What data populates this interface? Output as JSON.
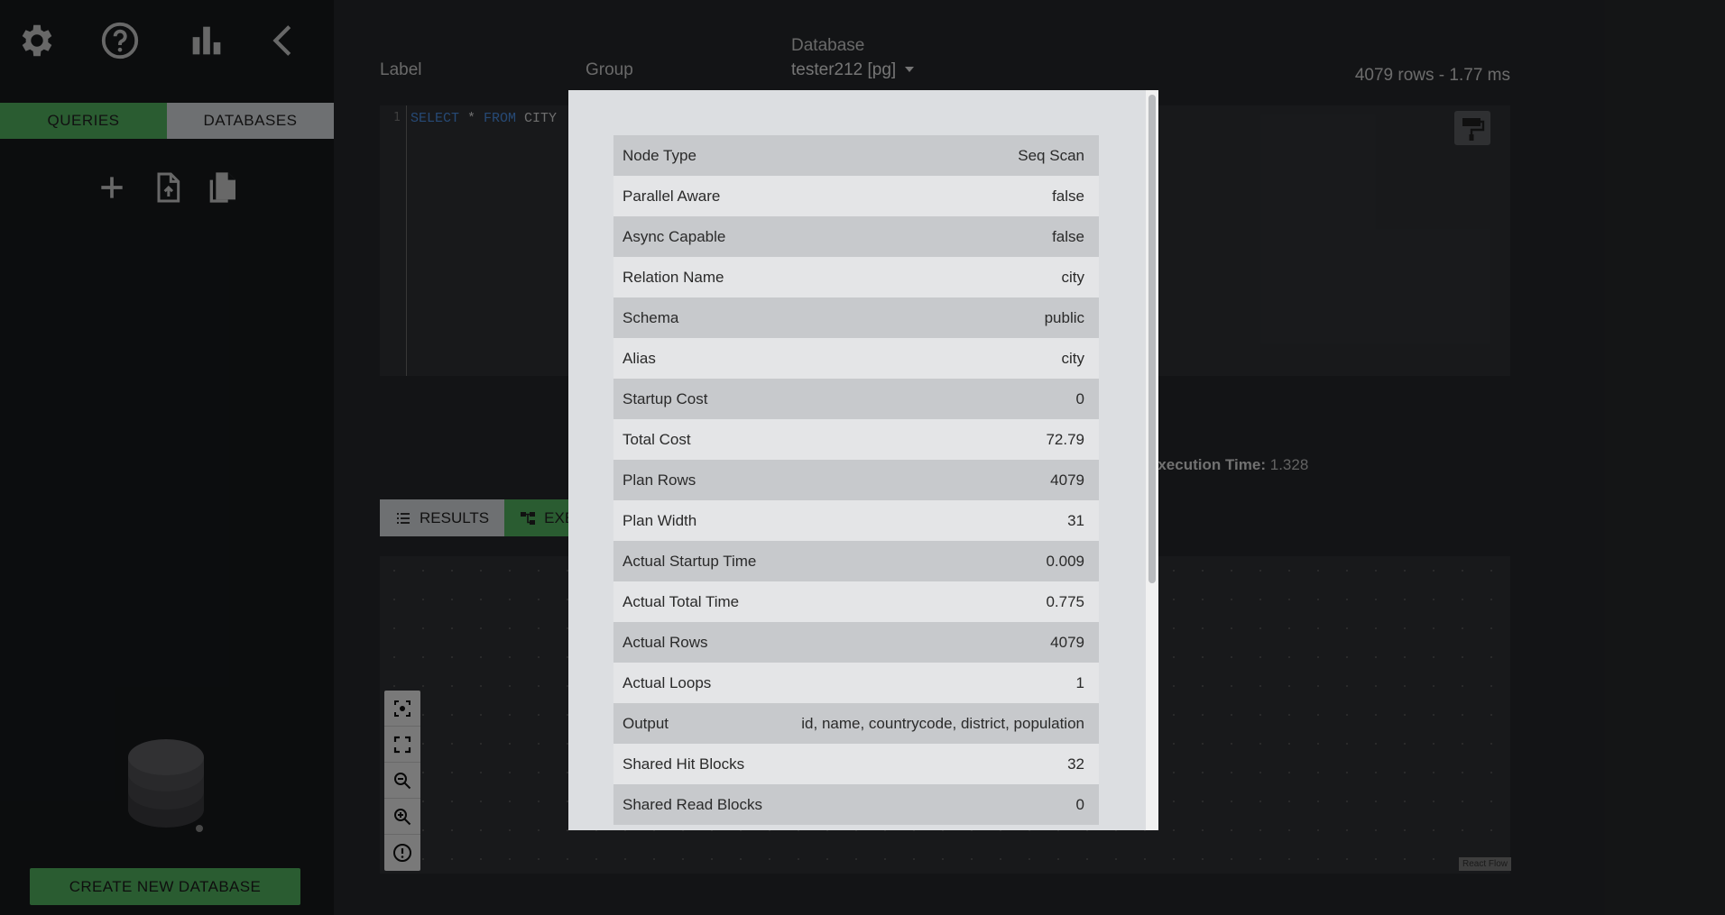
{
  "sidebar": {
    "tabs": {
      "queries": "QUERIES",
      "databases": "DATABASES"
    },
    "icons": [
      "gear-icon",
      "help-circle-icon",
      "bar-chart-icon",
      "chevron-left-icon"
    ],
    "actions": [
      "plus-icon",
      "file-upload-icon",
      "copy-icon"
    ],
    "create_button": "CREATE NEW DATABASE"
  },
  "header": {
    "label_field": "Label",
    "group_field": "Group",
    "database_label": "Database",
    "database_value": "tester212 [pg]",
    "rows_info": "4079 rows - 1.77 ms"
  },
  "editor": {
    "line_number": "1",
    "kw_select": "SELECT",
    "star": " * ",
    "kw_from": "FROM",
    "table": " CITY"
  },
  "execution": {
    "label": "Execution Time:",
    "value": "1.328"
  },
  "result_tabs": {
    "results": "RESULTS",
    "exec": "EXEC"
  },
  "flow": {
    "attribution": "React Flow"
  },
  "modal": {
    "rows": [
      {
        "key": "Node Type",
        "value": "Seq Scan"
      },
      {
        "key": "Parallel Aware",
        "value": "false"
      },
      {
        "key": "Async Capable",
        "value": "false"
      },
      {
        "key": "Relation Name",
        "value": "city"
      },
      {
        "key": "Schema",
        "value": "public"
      },
      {
        "key": "Alias",
        "value": "city"
      },
      {
        "key": "Startup Cost",
        "value": "0"
      },
      {
        "key": "Total Cost",
        "value": "72.79"
      },
      {
        "key": "Plan Rows",
        "value": "4079"
      },
      {
        "key": "Plan Width",
        "value": "31"
      },
      {
        "key": "Actual Startup Time",
        "value": "0.009"
      },
      {
        "key": "Actual Total Time",
        "value": "0.775"
      },
      {
        "key": "Actual Rows",
        "value": "4079"
      },
      {
        "key": "Actual Loops",
        "value": "1"
      },
      {
        "key": "Output",
        "value": "id, name, countrycode, district, population"
      },
      {
        "key": "Shared Hit Blocks",
        "value": "32"
      },
      {
        "key": "Shared Read Blocks",
        "value": "0"
      }
    ]
  },
  "colors": {
    "accent_green": "#52b15f",
    "tab_gray": "#d4d6da",
    "sidebar_bg": "#17191c"
  }
}
